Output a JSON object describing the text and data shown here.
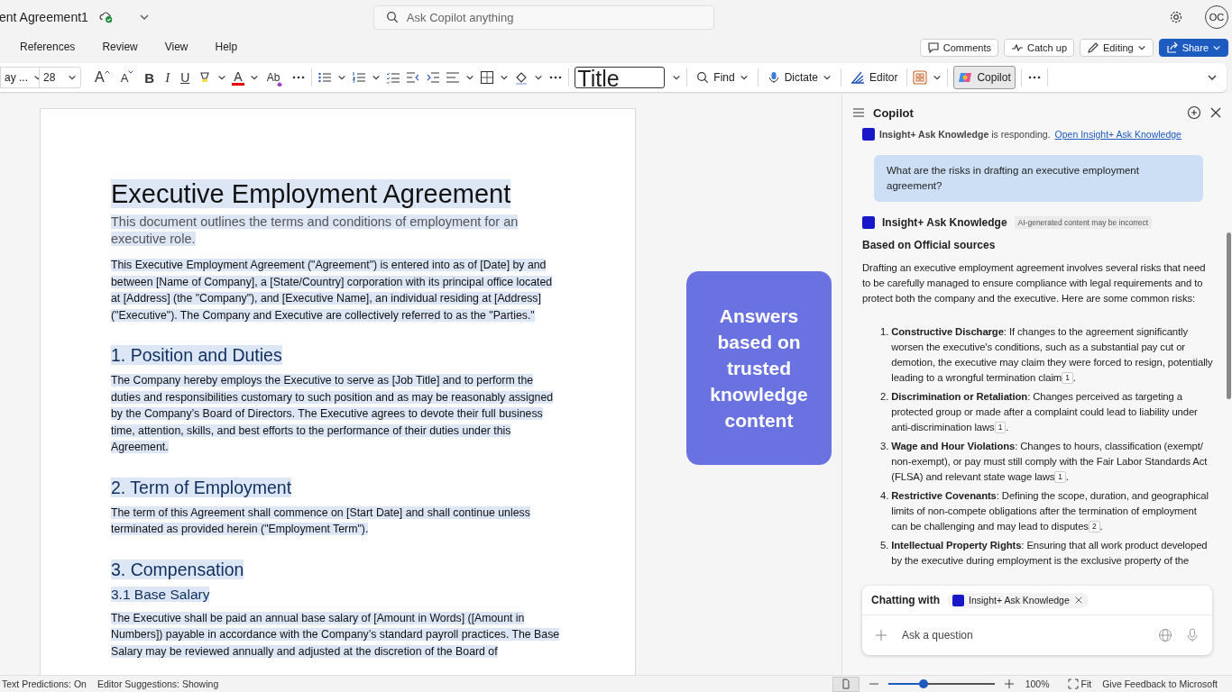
{
  "window": {
    "title": "ent Agreement1"
  },
  "search": {
    "placeholder": "Ask Copilot anything"
  },
  "account": {
    "initials": "OC"
  },
  "tabs": [
    {
      "label": "References",
      "selected": false
    },
    {
      "label": "Review",
      "selected": false
    },
    {
      "label": "View",
      "selected": false
    },
    {
      "label": "Help",
      "selected": false
    }
  ],
  "actions": [
    {
      "label": "Comments",
      "kind": "comments"
    },
    {
      "label": "Catch up",
      "kind": "catchup"
    },
    {
      "label": "Editing",
      "kind": "editing"
    },
    {
      "label": "Share",
      "kind": "share"
    }
  ],
  "ribbon": {
    "font": "ay ...",
    "size": "28",
    "grow": "A",
    "shrink": "A",
    "bold": "B",
    "italic": "I",
    "underline": "U",
    "font_color": "A",
    "clear": "Ab",
    "style": "Title",
    "find": "Find",
    "dictate": "Dictate",
    "editor": "Editor",
    "copilot": {
      "label": "Copilot",
      "selected": true
    }
  },
  "document": {
    "selected": true,
    "blocks": [
      {
        "kind": "title",
        "text": "Executive Employment Agreement"
      },
      {
        "kind": "subtitle",
        "text": "This document outlines the terms and conditions of employment for an executive role."
      },
      {
        "kind": "paragraph",
        "text": "This Executive Employment Agreement (\"Agreement\") is entered into as of [Date] by and between [Name of Company], a [State/Country] corporation with its principal office located at [Address] (the \"Company\"), and [Executive Name], an individual residing at [Address] (\"Executive\"). The Company and Executive are collectively referred to as the \"Parties.\""
      },
      {
        "kind": "heading1",
        "text": "1. Position and Duties"
      },
      {
        "kind": "paragraph",
        "text": "The Company hereby employs the Executive to serve as [Job Title] and to perform the duties and responsibilities customary to such position and as may be reasonably assigned by the Company’s Board of Directors. The Executive agrees to devote their full business time, attention, skills, and best efforts to the performance of their duties under this Agreement."
      },
      {
        "kind": "heading1",
        "text": "2. Term of Employment"
      },
      {
        "kind": "paragraph",
        "text": "The term of this Agreement shall commence on [Start Date] and shall continue unless terminated as provided herein (\"Employment Term\")."
      },
      {
        "kind": "heading1",
        "text": "3. Compensation"
      },
      {
        "kind": "heading2",
        "text": "3.1 Base Salary"
      },
      {
        "kind": "paragraph",
        "text": "The Executive shall be paid an annual base salary of [Amount in Words] ([Amount in Numbers]) payable in accordance with the Company’s standard payroll practices. The Base Salary may be reviewed annually and adjusted at the discretion of the Board of"
      }
    ]
  },
  "callout": "Answers based on trusted knowledge content",
  "copilot": {
    "title": "Copilot",
    "status": "**Insight+ Ask Knowledge** is responding.",
    "status_link": "Open Insight+ Ask Knowledge",
    "question": "What are the risks in drafting an executive employment agreement?",
    "agent": "Insight+ Ask Knowledge",
    "disclaimer": "AI-generated content may be incorrect",
    "heading": "Based on Official sources",
    "intro": "Drafting an executive employment agreement involves several risks that need to be carefully managed to ensure compliance with legal requirements and to protect both the company and the executive. Here are some common risks:",
    "risks": [
      {
        "number": "1.",
        "text": "**Constructive Discharge**: If changes to the agreement significantly worsen the executive's conditions, such as a substantial pay cut or demotion, the executive may claim they were forced to resign, potentially leading to a wrongful termination claim",
        "citation": "1",
        "end": "."
      },
      {
        "number": "2.",
        "text": "**Discrimination or Retaliation**: Changes perceived as targeting a protected group or made after a complaint could lead to liability under anti-discrimination laws",
        "citation": "1",
        "end": "."
      },
      {
        "number": "3.",
        "text": "**Wage and Hour Violations**: Changes to hours, classification (exempt/ non-exempt), or pay must still comply with the Fair Labor Standards Act (FLSA) and relevant state wage laws",
        "citation": "1",
        "end": "."
      },
      {
        "number": "4.",
        "text": "**Restrictive Covenants**: Defining the scope, duration, and geographical limits of non-compete obligations after the termination of employment can be challenging and may lead to disputes",
        "citation": "2",
        "end": "."
      },
      {
        "number": "5.",
        "text": "**Intellectual Property Rights**: Ensuring that all work product developed by the executive during employment is the exclusive property of the"
      }
    ]
  },
  "chat": {
    "label": "Chatting with",
    "agent": "Insight+ Ask Knowledge",
    "placeholder": "Ask a question"
  },
  "status_bar": {
    "items": [
      "Text Predictions: On",
      "Editor Suggestions: Showing"
    ],
    "zoom": {
      "level": 0.33
    },
    "zoom_text": "100%",
    "fit": "Fit",
    "feedback": "Give Feedback to Microsoft"
  }
}
